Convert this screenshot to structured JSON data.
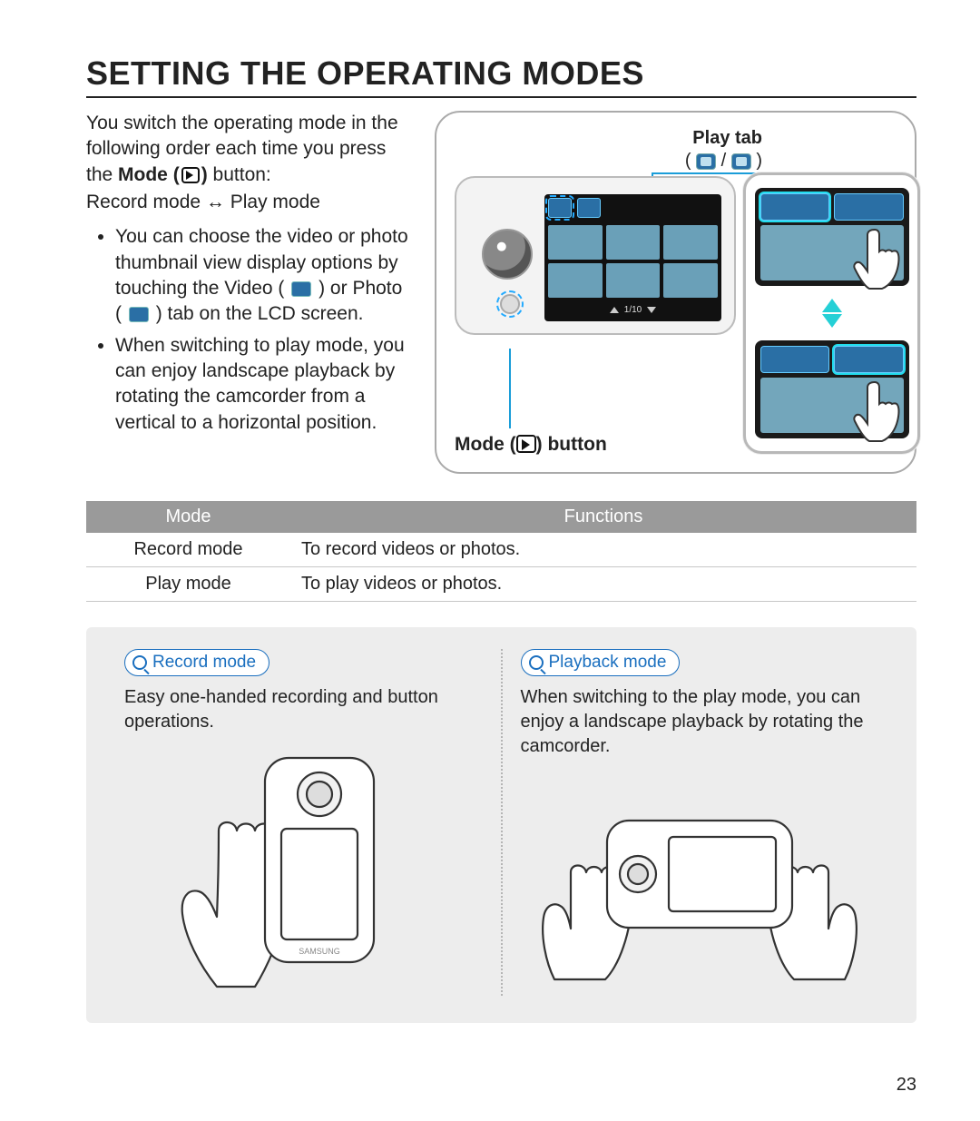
{
  "title": "SETTING THE OPERATING MODES",
  "intro": {
    "line1": "You switch the operating mode in the following order each time you press the ",
    "mode_word": "Mode",
    "button_word": " button:",
    "toggle_line": "Record mode ↔ Play mode",
    "bullet1a": "You can choose the video or photo thumbnail view display options by touching the Video (",
    "bullet1b": ") or Photo (",
    "bullet1c": ") tab on the LCD screen.",
    "bullet2": "When switching to play mode, you can enjoy landscape playback by rotating the camcorder from a vertical to a horizontal position."
  },
  "diagram": {
    "play_tab_label": "Play tab",
    "mode_button_label": "Mode (",
    "mode_button_label_end": ") button",
    "counter": "1/10"
  },
  "table": {
    "head_mode": "Mode",
    "head_func": "Functions",
    "rows": [
      {
        "mode": "Record mode",
        "func": "To record videos or photos."
      },
      {
        "mode": "Play mode",
        "func": "To play videos or photos."
      }
    ]
  },
  "panel": {
    "record_label": "Record mode",
    "record_desc": "Easy one-handed recording and button operations.",
    "playback_label": "Playback mode",
    "playback_desc": "When switching to the play mode, you can enjoy a landscape playback by rotating the camcorder.",
    "brand": "SAMSUNG"
  },
  "page_number": "23"
}
